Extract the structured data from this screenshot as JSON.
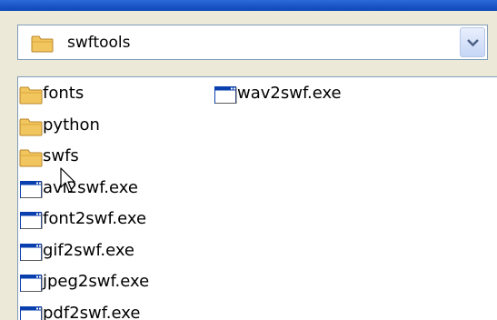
{
  "location": {
    "folder_name": "swftools",
    "icon": "folder-icon",
    "dropdown_icon": "chevron-down-icon"
  },
  "files": [
    {
      "name": "fonts",
      "type": "folder"
    },
    {
      "name": "python",
      "type": "folder"
    },
    {
      "name": "swfs",
      "type": "folder"
    },
    {
      "name": "avi2swf.exe",
      "type": "exe"
    },
    {
      "name": "font2swf.exe",
      "type": "exe"
    },
    {
      "name": "gif2swf.exe",
      "type": "exe"
    },
    {
      "name": "jpeg2swf.exe",
      "type": "exe"
    },
    {
      "name": "pdf2swf.exe",
      "type": "exe"
    },
    {
      "name": "wav2swf.exe",
      "type": "exe"
    }
  ],
  "colors": {
    "titlebar": "#1a54c4",
    "folder": "#f2c65e",
    "exe_titlebar": "#0a3fae"
  }
}
